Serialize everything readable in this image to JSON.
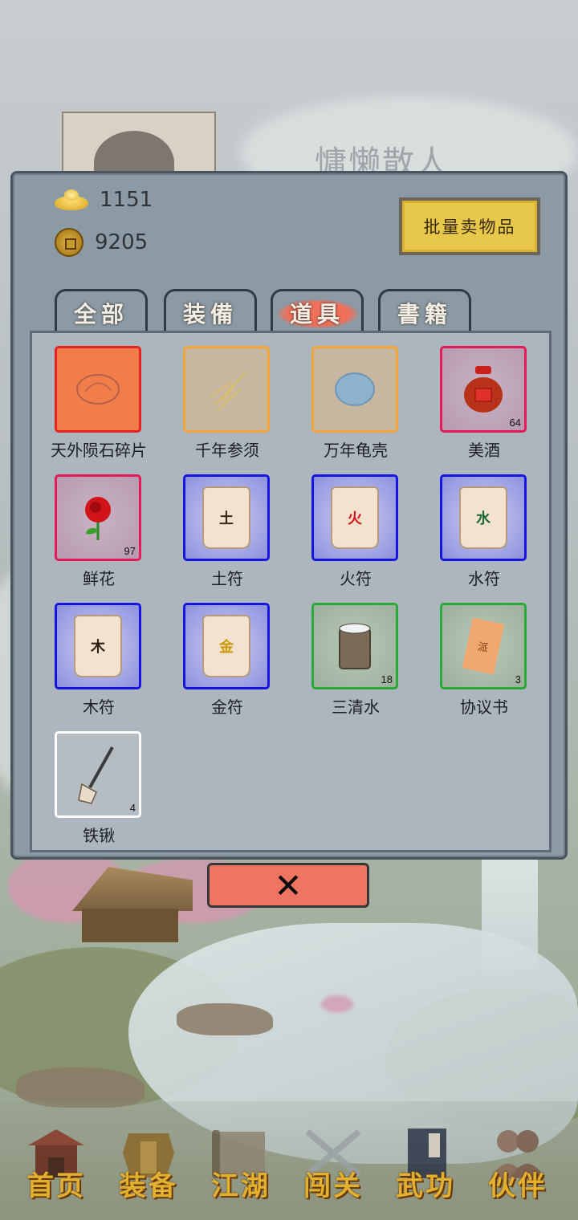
{
  "player": {
    "name": "慵懒散人"
  },
  "wallet": {
    "gold_ingot": "1151",
    "copper_coin": "9205"
  },
  "actions": {
    "bulk_sell_label": "批量卖物品",
    "close_label": "✕"
  },
  "tabs": [
    {
      "label": "全部",
      "active": false
    },
    {
      "label": "装備",
      "active": false
    },
    {
      "label": "道具",
      "active": true
    },
    {
      "label": "書籍",
      "active": false
    }
  ],
  "items": [
    {
      "name": "天外陨石碎片",
      "rarity": "orange",
      "icon": "meteorite-icon",
      "count": ""
    },
    {
      "name": "千年参须",
      "rarity": "gold",
      "icon": "ginseng-icon",
      "count": ""
    },
    {
      "name": "万年龟壳",
      "rarity": "gold",
      "icon": "turtle-shell-icon",
      "count": ""
    },
    {
      "name": "美酒",
      "rarity": "red",
      "icon": "wine-jar-icon",
      "count": "64"
    },
    {
      "name": "鲜花",
      "rarity": "red",
      "icon": "rose-icon",
      "count": "97"
    },
    {
      "name": "土符",
      "rarity": "blue",
      "icon": "talisman-icon",
      "glyph": "土",
      "count": ""
    },
    {
      "name": "火符",
      "rarity": "blue",
      "icon": "talisman-icon",
      "glyph": "火",
      "count": ""
    },
    {
      "name": "水符",
      "rarity": "blue",
      "icon": "talisman-icon",
      "glyph": "水",
      "count": ""
    },
    {
      "name": "木符",
      "rarity": "blue",
      "icon": "talisman-icon",
      "glyph": "木",
      "count": ""
    },
    {
      "name": "金符",
      "rarity": "blue",
      "icon": "talisman-icon",
      "glyph": "金",
      "count": ""
    },
    {
      "name": "三清水",
      "rarity": "green",
      "icon": "water-bucket-icon",
      "count": "18"
    },
    {
      "name": "协议书",
      "rarity": "green",
      "icon": "contract-scroll-icon",
      "glyph": "派",
      "count": "3"
    },
    {
      "name": "铁锹",
      "rarity": "white",
      "icon": "shovel-icon",
      "count": "4"
    }
  ],
  "nav": [
    {
      "label": "首页",
      "icon": "house-icon"
    },
    {
      "label": "装备",
      "icon": "armor-icon"
    },
    {
      "label": "江湖",
      "icon": "scroll-map-icon"
    },
    {
      "label": "闯关",
      "icon": "crossed-swords-icon"
    },
    {
      "label": "武功",
      "icon": "book-icon"
    },
    {
      "label": "伙伴",
      "icon": "partners-icon"
    }
  ],
  "colors": {
    "rarity_orange": "#e52323",
    "rarity_gold": "#f2a53a",
    "rarity_red": "#e11c56",
    "rarity_blue": "#1416e0",
    "rarity_green": "#2aa83a",
    "rarity_white": "#ffffff",
    "nav_label": "#e1b02e",
    "sell_button": "#e8c84a",
    "close_button": "#ee7561"
  }
}
